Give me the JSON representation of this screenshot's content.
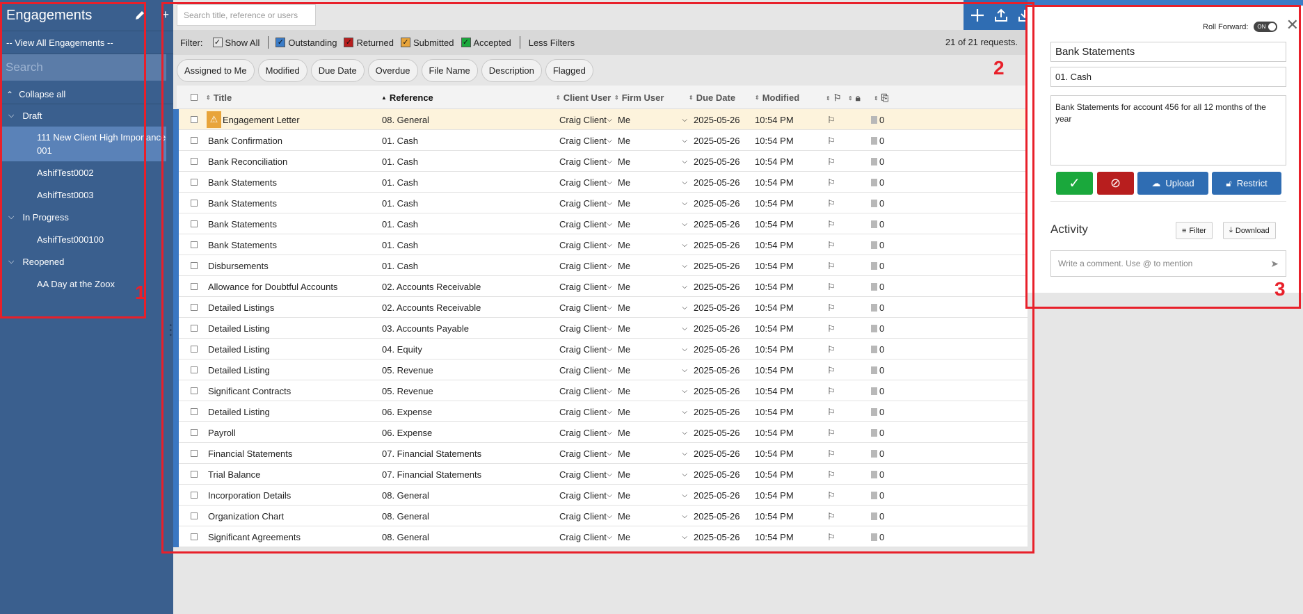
{
  "sidebar": {
    "title": "Engagements",
    "view_all": "-- View All Engagements --",
    "search_placeholder": "Search",
    "collapse_all": "Collapse all",
    "groups": [
      {
        "label": "Draft",
        "items": [
          "111 New Client High Importance 001",
          "AshifTest0002",
          "AshifTest0003"
        ]
      },
      {
        "label": "In Progress",
        "items": [
          "AshifTest000100"
        ]
      },
      {
        "label": "Reopened",
        "items": [
          "AA Day at the Zoox"
        ]
      }
    ]
  },
  "main": {
    "search_placeholder": "Search title, reference or users",
    "filter": {
      "label": "Filter:",
      "options": [
        {
          "label": "Show All",
          "color": "#e6e6e6",
          "checked": true
        },
        {
          "label": "Outstanding",
          "color": "#3b7cc7",
          "checked": true
        },
        {
          "label": "Returned",
          "color": "#b81e1e",
          "checked": true
        },
        {
          "label": "Submitted",
          "color": "#e8a43a",
          "checked": true
        },
        {
          "label": "Accepted",
          "color": "#1aa83c",
          "checked": true
        }
      ],
      "less_filters": "Less Filters",
      "count": "21 of 21 requests."
    },
    "chips": [
      "Assigned to Me",
      "Modified",
      "Due Date",
      "Overdue",
      "File Name",
      "Description",
      "Flagged"
    ],
    "columns": {
      "title": "Title",
      "reference": "Reference",
      "client_user": "Client User",
      "firm_user": "Firm User",
      "due_date": "Due Date",
      "modified": "Modified"
    },
    "rows": [
      {
        "title": "Engagement Letter",
        "reference": "08. General",
        "client": "Craig Client",
        "firm": "Me",
        "due": "2025-05-26",
        "modified": "10:54 PM",
        "files": "0",
        "warn": true
      },
      {
        "title": "Bank Confirmation",
        "reference": "01. Cash",
        "client": "Craig Client",
        "firm": "Me",
        "due": "2025-05-26",
        "modified": "10:54 PM",
        "files": "0"
      },
      {
        "title": "Bank Reconciliation",
        "reference": "01. Cash",
        "client": "Craig Client",
        "firm": "Me",
        "due": "2025-05-26",
        "modified": "10:54 PM",
        "files": "0"
      },
      {
        "title": "Bank Statements",
        "reference": "01. Cash",
        "client": "Craig Client",
        "firm": "Me",
        "due": "2025-05-26",
        "modified": "10:54 PM",
        "files": "0"
      },
      {
        "title": "Bank Statements",
        "reference": "01. Cash",
        "client": "Craig Client",
        "firm": "Me",
        "due": "2025-05-26",
        "modified": "10:54 PM",
        "files": "0"
      },
      {
        "title": "Bank Statements",
        "reference": "01. Cash",
        "client": "Craig Client",
        "firm": "Me",
        "due": "2025-05-26",
        "modified": "10:54 PM",
        "files": "0"
      },
      {
        "title": "Bank Statements",
        "reference": "01. Cash",
        "client": "Craig Client",
        "firm": "Me",
        "due": "2025-05-26",
        "modified": "10:54 PM",
        "files": "0"
      },
      {
        "title": "Disbursements",
        "reference": "01. Cash",
        "client": "Craig Client",
        "firm": "Me",
        "due": "2025-05-26",
        "modified": "10:54 PM",
        "files": "0"
      },
      {
        "title": "Allowance for Doubtful Accounts",
        "reference": "02. Accounts Receivable",
        "client": "Craig Client",
        "firm": "Me",
        "due": "2025-05-26",
        "modified": "10:54 PM",
        "files": "0"
      },
      {
        "title": "Detailed Listings",
        "reference": "02. Accounts Receivable",
        "client": "Craig Client",
        "firm": "Me",
        "due": "2025-05-26",
        "modified": "10:54 PM",
        "files": "0"
      },
      {
        "title": "Detailed Listing",
        "reference": "03. Accounts Payable",
        "client": "Craig Client",
        "firm": "Me",
        "due": "2025-05-26",
        "modified": "10:54 PM",
        "files": "0"
      },
      {
        "title": "Detailed Listing",
        "reference": "04. Equity",
        "client": "Craig Client",
        "firm": "Me",
        "due": "2025-05-26",
        "modified": "10:54 PM",
        "files": "0"
      },
      {
        "title": "Detailed Listing",
        "reference": "05. Revenue",
        "client": "Craig Client",
        "firm": "Me",
        "due": "2025-05-26",
        "modified": "10:54 PM",
        "files": "0"
      },
      {
        "title": "Significant Contracts",
        "reference": "05. Revenue",
        "client": "Craig Client",
        "firm": "Me",
        "due": "2025-05-26",
        "modified": "10:54 PM",
        "files": "0"
      },
      {
        "title": "Detailed Listing",
        "reference": "06. Expense",
        "client": "Craig Client",
        "firm": "Me",
        "due": "2025-05-26",
        "modified": "10:54 PM",
        "files": "0"
      },
      {
        "title": "Payroll",
        "reference": "06. Expense",
        "client": "Craig Client",
        "firm": "Me",
        "due": "2025-05-26",
        "modified": "10:54 PM",
        "files": "0"
      },
      {
        "title": "Financial Statements",
        "reference": "07. Financial Statements",
        "client": "Craig Client",
        "firm": "Me",
        "due": "2025-05-26",
        "modified": "10:54 PM",
        "files": "0"
      },
      {
        "title": "Trial Balance",
        "reference": "07. Financial Statements",
        "client": "Craig Client",
        "firm": "Me",
        "due": "2025-05-26",
        "modified": "10:54 PM",
        "files": "0"
      },
      {
        "title": "Incorporation Details",
        "reference": "08. General",
        "client": "Craig Client",
        "firm": "Me",
        "due": "2025-05-26",
        "modified": "10:54 PM",
        "files": "0"
      },
      {
        "title": "Organization Chart",
        "reference": "08. General",
        "client": "Craig Client",
        "firm": "Me",
        "due": "2025-05-26",
        "modified": "10:54 PM",
        "files": "0"
      },
      {
        "title": "Significant Agreements",
        "reference": "08. General",
        "client": "Craig Client",
        "firm": "Me",
        "due": "2025-05-26",
        "modified": "10:54 PM",
        "files": "0"
      }
    ]
  },
  "detail": {
    "roll_forward_label": "Roll Forward:",
    "toggle_state": "ON",
    "title": "Bank Statements",
    "reference": "01. Cash",
    "description": "Bank Statements for account 456 for all 12 months of the year",
    "upload_label": "Upload",
    "restrict_label": "Restrict",
    "activity_title": "Activity",
    "filter_label": "Filter",
    "download_label": "Download",
    "comment_placeholder": "Write a comment. Use @ to mention"
  },
  "annotations": [
    "1",
    "2",
    "3"
  ],
  "colors": {
    "annotation": "#e8202a",
    "sidebar": "#3a5f8e",
    "primary": "#2f6db3",
    "accept": "#1aa83c",
    "reject": "#b81e1e"
  }
}
